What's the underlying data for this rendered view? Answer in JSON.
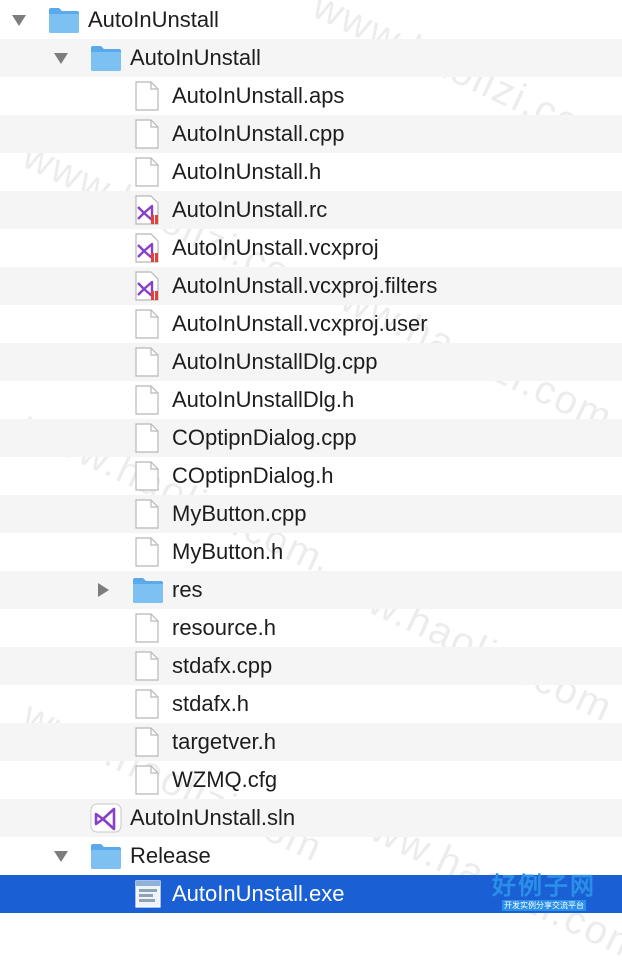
{
  "tree": {
    "rows": [
      {
        "label": "AutoInUnstall",
        "icon": "folder-icon",
        "disclosure": "open"
      },
      {
        "label": "AutoInUnstall",
        "icon": "folder-icon",
        "disclosure": "open"
      },
      {
        "label": "AutoInUnstall.aps",
        "icon": "file-icon"
      },
      {
        "label": "AutoInUnstall.cpp",
        "icon": "file-icon"
      },
      {
        "label": "AutoInUnstall.h",
        "icon": "file-icon"
      },
      {
        "label": "AutoInUnstall.rc",
        "icon": "visual-studio-file-icon"
      },
      {
        "label": "AutoInUnstall.vcxproj",
        "icon": "visual-studio-file-icon"
      },
      {
        "label": "AutoInUnstall.vcxproj.filters",
        "icon": "visual-studio-file-icon"
      },
      {
        "label": "AutoInUnstall.vcxproj.user",
        "icon": "file-icon"
      },
      {
        "label": "AutoInUnstallDlg.cpp",
        "icon": "file-icon"
      },
      {
        "label": "AutoInUnstallDlg.h",
        "icon": "file-icon"
      },
      {
        "label": "COptipnDialog.cpp",
        "icon": "file-icon"
      },
      {
        "label": "COptipnDialog.h",
        "icon": "file-icon"
      },
      {
        "label": "MyButton.cpp",
        "icon": "file-icon"
      },
      {
        "label": "MyButton.h",
        "icon": "file-icon"
      },
      {
        "label": "res",
        "icon": "folder-icon",
        "disclosure": "closed"
      },
      {
        "label": "resource.h",
        "icon": "file-icon"
      },
      {
        "label": "stdafx.cpp",
        "icon": "file-icon"
      },
      {
        "label": "stdafx.h",
        "icon": "file-icon"
      },
      {
        "label": "targetver.h",
        "icon": "file-icon"
      },
      {
        "label": "WZMQ.cfg",
        "icon": "file-icon"
      },
      {
        "label": "AutoInUnstall.sln",
        "icon": "visual-studio-solution-icon"
      },
      {
        "label": "Release",
        "icon": "folder-icon",
        "disclosure": "open"
      },
      {
        "label": "AutoInUnstall.exe",
        "icon": "executable-icon",
        "selected": true
      }
    ]
  },
  "watermark": {
    "text": "www.haolizi.com"
  },
  "logo": {
    "title": "好例子网",
    "subtitle": "开发实例分享交流平台"
  },
  "colors": {
    "selection": "#1a5fd3",
    "folder": "#6cb6f0",
    "vs_purple": "#8a3fc9",
    "vs_red": "#e2403a",
    "alt_row": "#f5f5f5"
  }
}
